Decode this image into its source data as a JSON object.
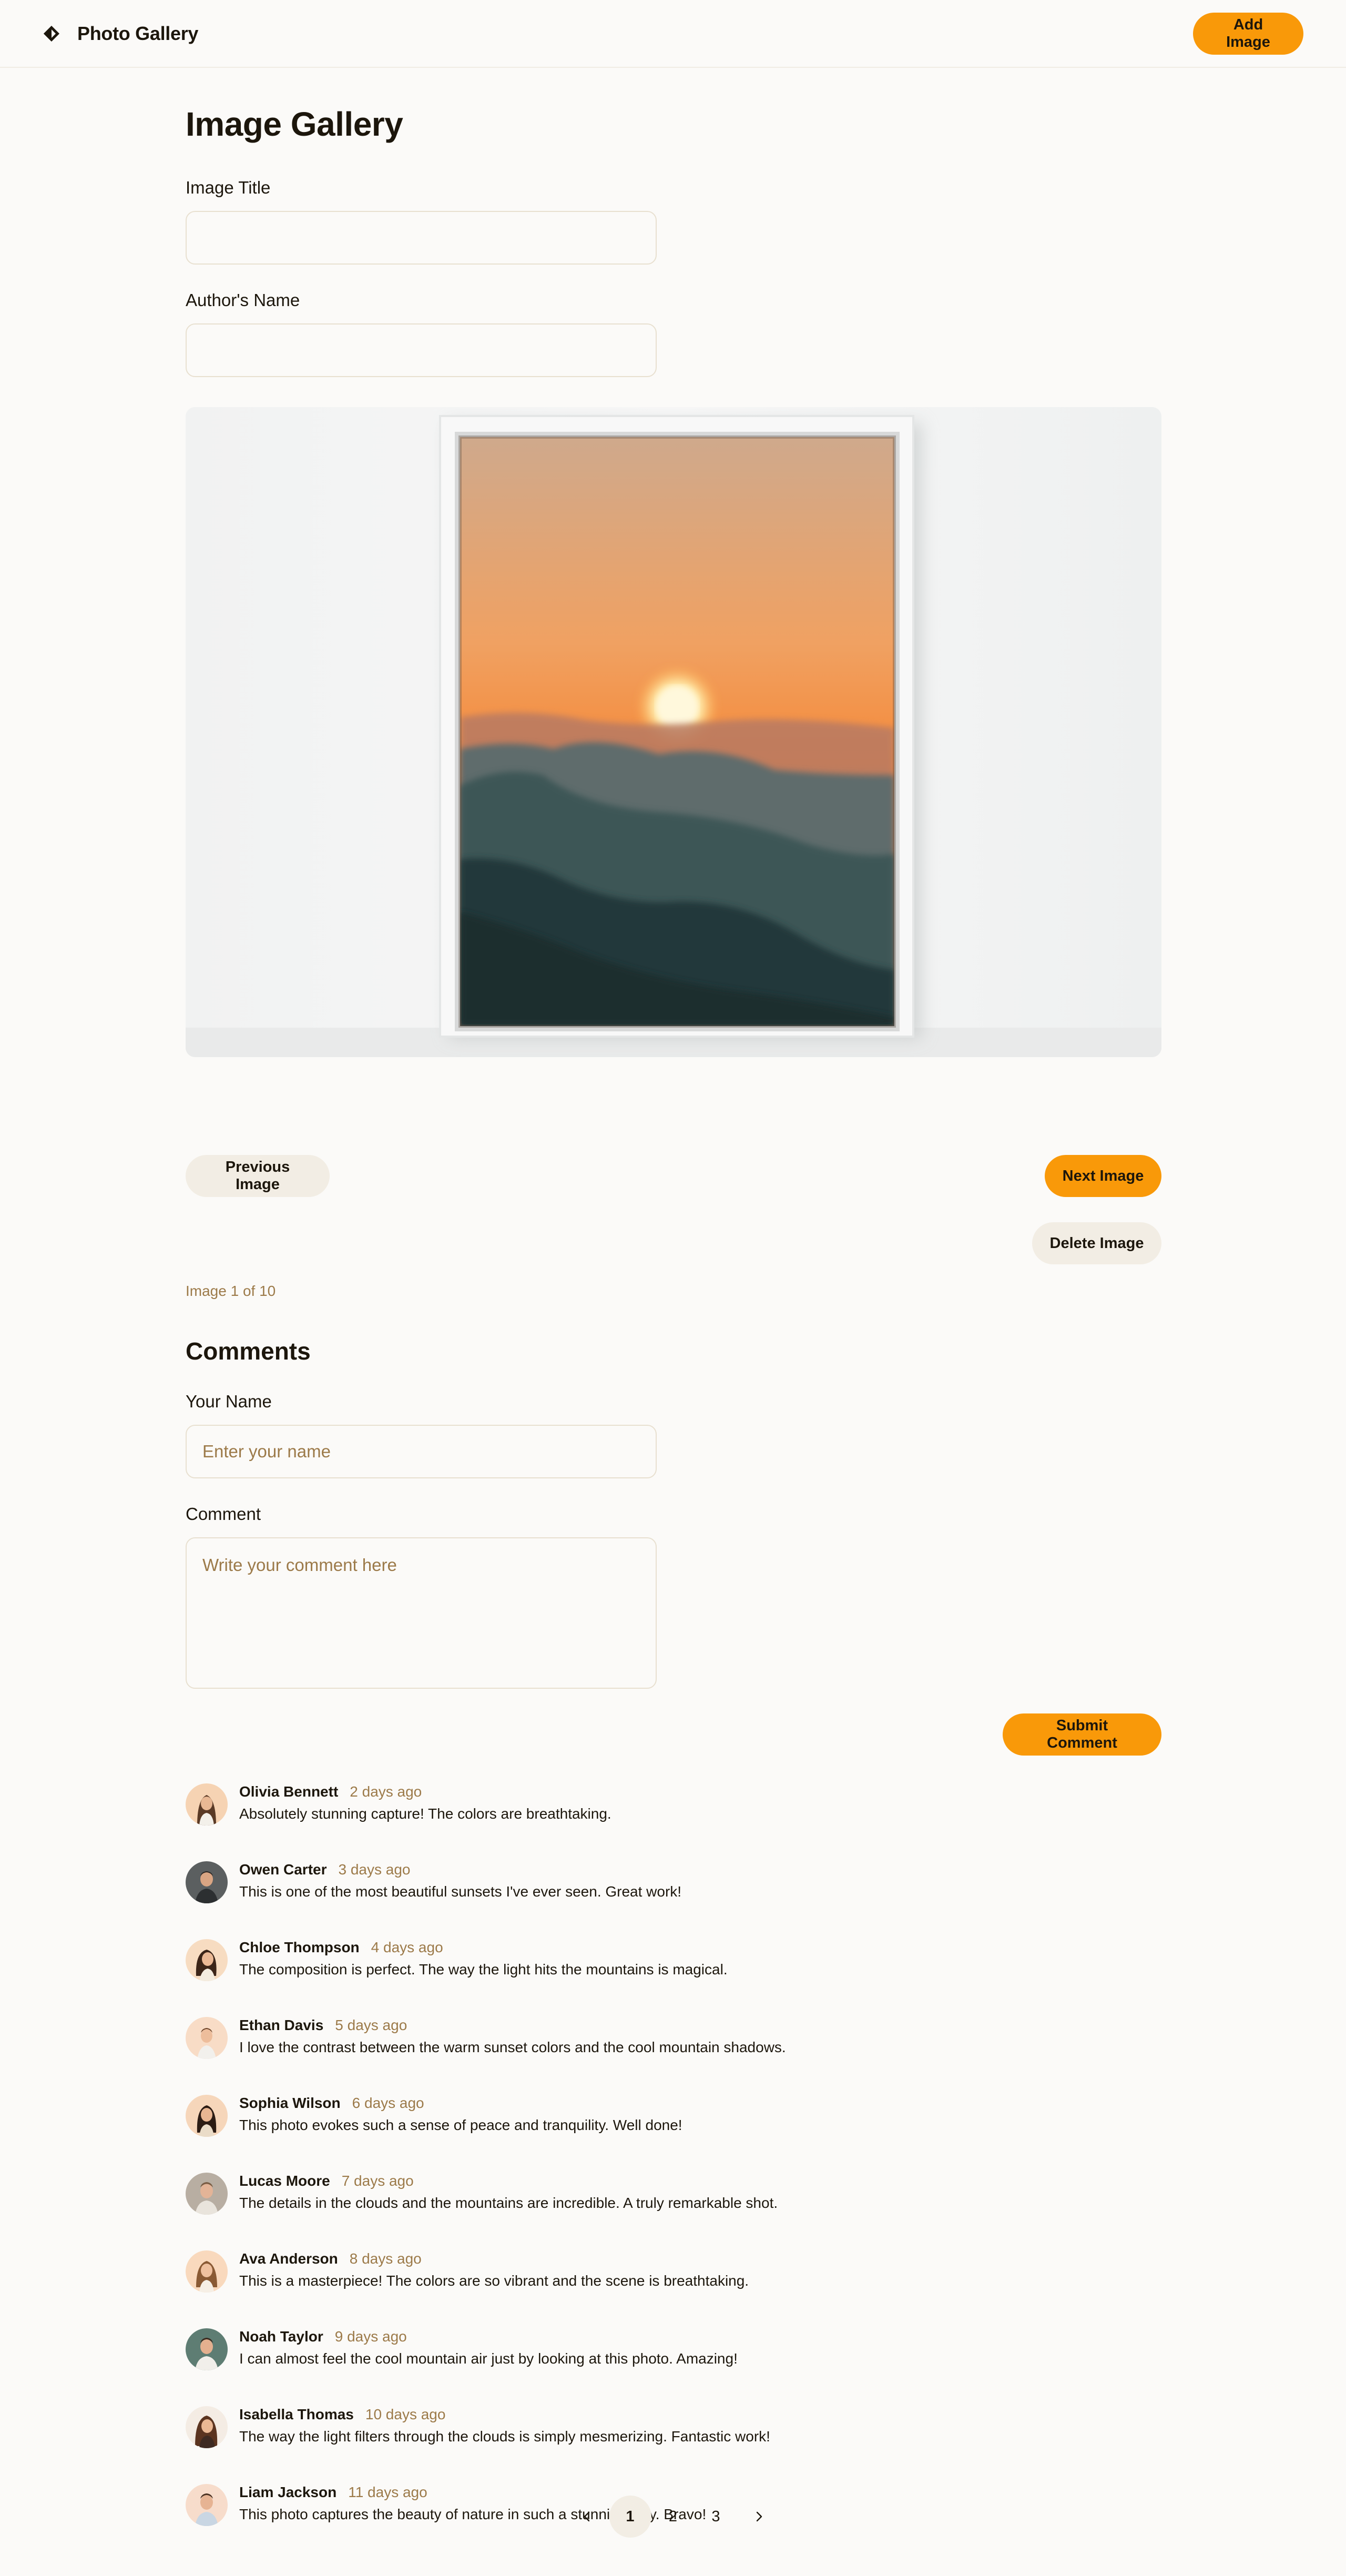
{
  "header": {
    "title": "Photo Gallery",
    "add_image_label": "Add Image"
  },
  "main": {
    "page_title": "Image Gallery",
    "image_title_label": "Image Title",
    "image_title_value": "",
    "author_label": "Author's Name",
    "author_value": "",
    "previous_label": "Previous Image",
    "next_label": "Next Image",
    "delete_label": "Delete Image",
    "counter": "Image 1 of 10"
  },
  "comments": {
    "title": "Comments",
    "name_label": "Your Name",
    "name_placeholder": "Enter your name",
    "comment_label": "Comment",
    "comment_placeholder": "Write your comment here",
    "submit_label": "Submit Comment",
    "items": [
      {
        "name": "Olivia Bennett",
        "time": "2 days ago",
        "text": "Absolutely stunning capture! The colors are breathtaking."
      },
      {
        "name": "Owen Carter",
        "time": "3 days ago",
        "text": "This is one of the most beautiful sunsets I've ever seen. Great work!"
      },
      {
        "name": "Chloe Thompson",
        "time": "4 days ago",
        "text": "The composition is perfect. The way the light hits the mountains is magical."
      },
      {
        "name": "Ethan Davis",
        "time": "5 days ago",
        "text": "I love the contrast between the warm sunset colors and the cool mountain shadows."
      },
      {
        "name": "Sophia Wilson",
        "time": "6 days ago",
        "text": "This photo evokes such a sense of peace and tranquility. Well done!"
      },
      {
        "name": "Lucas Moore",
        "time": "7 days ago",
        "text": "The details in the clouds and the mountains are incredible. A truly remarkable shot."
      },
      {
        "name": "Ava Anderson",
        "time": "8 days ago",
        "text": "This is a masterpiece! The colors are so vibrant and the scene is breathtaking."
      },
      {
        "name": "Noah Taylor",
        "time": "9 days ago",
        "text": "I can almost feel the cool mountain air just by looking at this photo. Amazing!"
      },
      {
        "name": "Isabella Thomas",
        "time": "10 days ago",
        "text": "The way the light filters through the clouds is simply mesmerizing. Fantastic work!"
      },
      {
        "name": "Liam Jackson",
        "time": "11 days ago",
        "text": "This photo captures the beauty of nature in such a stunning way. Bravo!"
      }
    ]
  },
  "pagination": {
    "pages": [
      "1",
      "2",
      "3"
    ],
    "current": "1"
  },
  "colors": {
    "accent": "#f99909",
    "secondary_button": "#f2ede4",
    "muted_text": "#9c7a49",
    "background": "#fbfaf8"
  },
  "icons": {
    "logo": "diamond-logo-icon",
    "prev": "chevron-left-icon",
    "next": "chevron-right-icon"
  }
}
